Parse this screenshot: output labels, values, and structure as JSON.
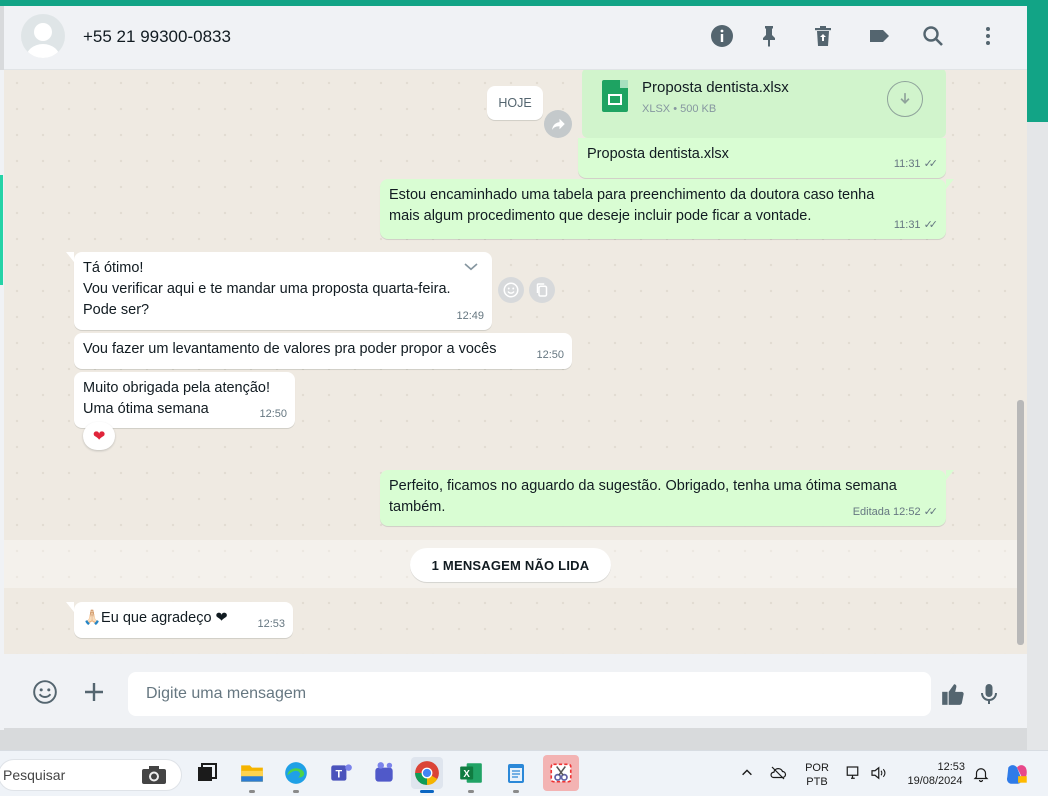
{
  "header": {
    "contact_name": "+55 21 99300-0833",
    "icons": [
      "info-icon",
      "pin-icon",
      "delete-icon",
      "label-icon",
      "search-icon",
      "menu-icon"
    ]
  },
  "chat": {
    "date_badge": "HOJE",
    "document": {
      "file_name": "Proposta dentista.xlsx",
      "file_type": "XLSX",
      "file_size": "500 KB"
    },
    "messages": [
      {
        "direction": "out",
        "text": "Proposta dentista.xlsx",
        "time": "11:31"
      },
      {
        "direction": "out",
        "text": "Estou encaminhado uma tabela para preenchimento da doutora caso tenha mais algum procedimento que deseje incluir pode ficar a vontade.",
        "time": "11:31"
      },
      {
        "direction": "in",
        "line1": "Tá ótimo!",
        "line2": "Vou verificar aqui e te mandar uma proposta quarta-feira.",
        "line3": "Pode ser?",
        "time": "12:49"
      },
      {
        "direction": "in",
        "text": "Vou fazer um levantamento de valores pra poder propor a vocês",
        "time": "12:50"
      },
      {
        "direction": "in",
        "line1": "Muito obrigada pela atenção!",
        "line2": "Uma ótima semana",
        "time": "12:50",
        "reaction": "❤"
      },
      {
        "direction": "out",
        "text": "Perfeito, ficamos no aguardo da sugestão. Obrigado, tenha uma ótima semana também.",
        "edited_label": "Editada",
        "time": "12:52"
      },
      {
        "direction": "in",
        "text": "🙏🏻Eu que agradeço ❤",
        "time": "12:53"
      }
    ],
    "unread_label": "1 MENSAGEM NÃO LIDA"
  },
  "composer": {
    "placeholder": "Digite uma mensagem"
  },
  "taskbar": {
    "search_placeholder": "Pesquisar",
    "language_line1": "POR",
    "language_line2": "PTB",
    "time": "12:53",
    "date": "19/08/2024"
  },
  "colors": {
    "accent": "#12a486",
    "outgoing": "#d9fdd3",
    "incoming": "#ffffff",
    "chat_bg": "#efeae2"
  }
}
